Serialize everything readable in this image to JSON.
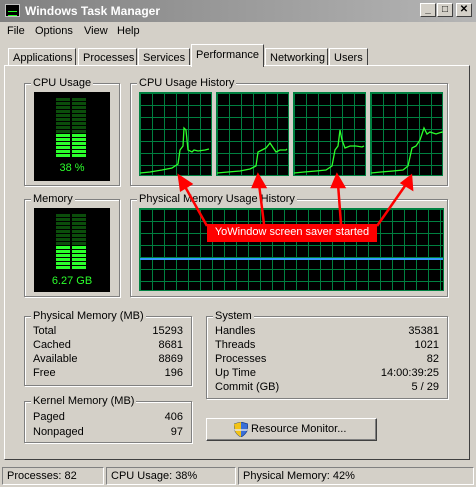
{
  "window": {
    "title": "Windows Task Manager",
    "controls": {
      "minimize": "_",
      "maximize": "□",
      "close": "✕"
    }
  },
  "menu": [
    "File",
    "Options",
    "View",
    "Help"
  ],
  "tabs": [
    "Applications",
    "Processes",
    "Services",
    "Performance",
    "Networking",
    "Users"
  ],
  "active_tab": "Performance",
  "cpu": {
    "label": "CPU Usage",
    "value": "38 %",
    "level": 0.38
  },
  "cpu_history": {
    "label": "CPU Usage History"
  },
  "memory": {
    "label": "Memory",
    "value": "6.27 GB",
    "level": 0.42
  },
  "memory_history": {
    "label": "Physical Memory Usage History"
  },
  "annotation": "YoWindow screen saver started",
  "physical_memory": {
    "label": "Physical Memory (MB)",
    "rows": [
      {
        "k": "Total",
        "v": "15293"
      },
      {
        "k": "Cached",
        "v": "8681"
      },
      {
        "k": "Available",
        "v": "8869"
      },
      {
        "k": "Free",
        "v": "196"
      }
    ]
  },
  "kernel_memory": {
    "label": "Kernel Memory (MB)",
    "rows": [
      {
        "k": "Paged",
        "v": "406"
      },
      {
        "k": "Nonpaged",
        "v": "97"
      }
    ]
  },
  "system": {
    "label": "System",
    "rows": [
      {
        "k": "Handles",
        "v": "35381"
      },
      {
        "k": "Threads",
        "v": "1021"
      },
      {
        "k": "Processes",
        "v": "82"
      },
      {
        "k": "Up Time",
        "v": "14:00:39:25"
      },
      {
        "k": "Commit (GB)",
        "v": "5 / 29"
      }
    ]
  },
  "resource_monitor_button": "Resource Monitor...",
  "status": {
    "processes": "Processes: 82",
    "cpu": "CPU Usage: 38%",
    "memory": "Physical Memory: 42%"
  },
  "colors": {
    "graph_line": "#2cff2c",
    "graph_grid": "#008040",
    "memory_line": "#3399ff",
    "annotation": "#ff0000"
  }
}
